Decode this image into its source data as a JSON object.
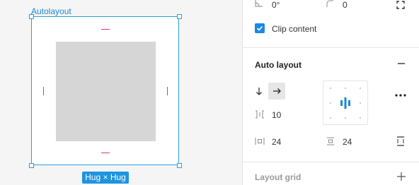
{
  "canvas": {
    "frame_label": "Autolayout",
    "size_badge": "Hug × Hug"
  },
  "panel": {
    "rotation_value": "0°",
    "corner_radius_value": "0",
    "clip_content_label": "Clip content",
    "clip_content_checked": true,
    "auto_layout_title": "Auto layout",
    "spacing_value": "10",
    "horizontal_padding_value": "24",
    "vertical_padding_value": "24",
    "layout_grid_title": "Layout grid"
  },
  "colors": {
    "selection_blue": "#2f9ddc",
    "padding_magenta": "#e0337f",
    "checkbox_blue": "#1e88e5"
  }
}
